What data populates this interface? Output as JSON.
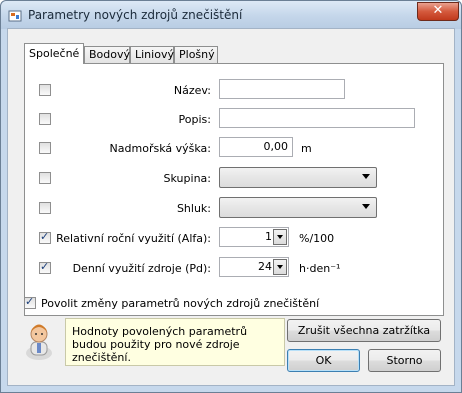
{
  "window": {
    "title": "Parametry nových zdrojů znečištění",
    "close_glyph": "✕"
  },
  "tabs": [
    {
      "label": "Společné",
      "active": true
    },
    {
      "label": "Bodový",
      "active": false
    },
    {
      "label": "Liniový",
      "active": false
    },
    {
      "label": "Plošný",
      "active": false
    }
  ],
  "fields": {
    "nazev": {
      "label": "Název:",
      "value": "",
      "checked": false
    },
    "popis": {
      "label": "Popis:",
      "value": "",
      "checked": false
    },
    "vyska": {
      "label": "Nadmořská výška:",
      "value": "0,00",
      "unit": "m",
      "checked": false
    },
    "skupina": {
      "label": "Skupina:",
      "value": "",
      "checked": false
    },
    "shluk": {
      "label": "Shluk:",
      "value": "",
      "checked": false
    },
    "alfa": {
      "label": "Relativní roční využití  (Alfa):",
      "value": "1",
      "unit": "%/100",
      "checked": true
    },
    "pd": {
      "label": "Denní využití zdroje (Pd):",
      "value": "24",
      "unit": "h·den⁻¹",
      "checked": true
    }
  },
  "allow_changes": {
    "label": "Povolit změny parametrů nových zdrojů znečištění",
    "checked": true
  },
  "info_text": "Hodnoty povolených parametrů budou použity pro nové zdroje znečištění.",
  "buttons": {
    "clear_all": "Zrušit všechna zatržítka",
    "ok": "OK",
    "cancel": "Storno"
  }
}
